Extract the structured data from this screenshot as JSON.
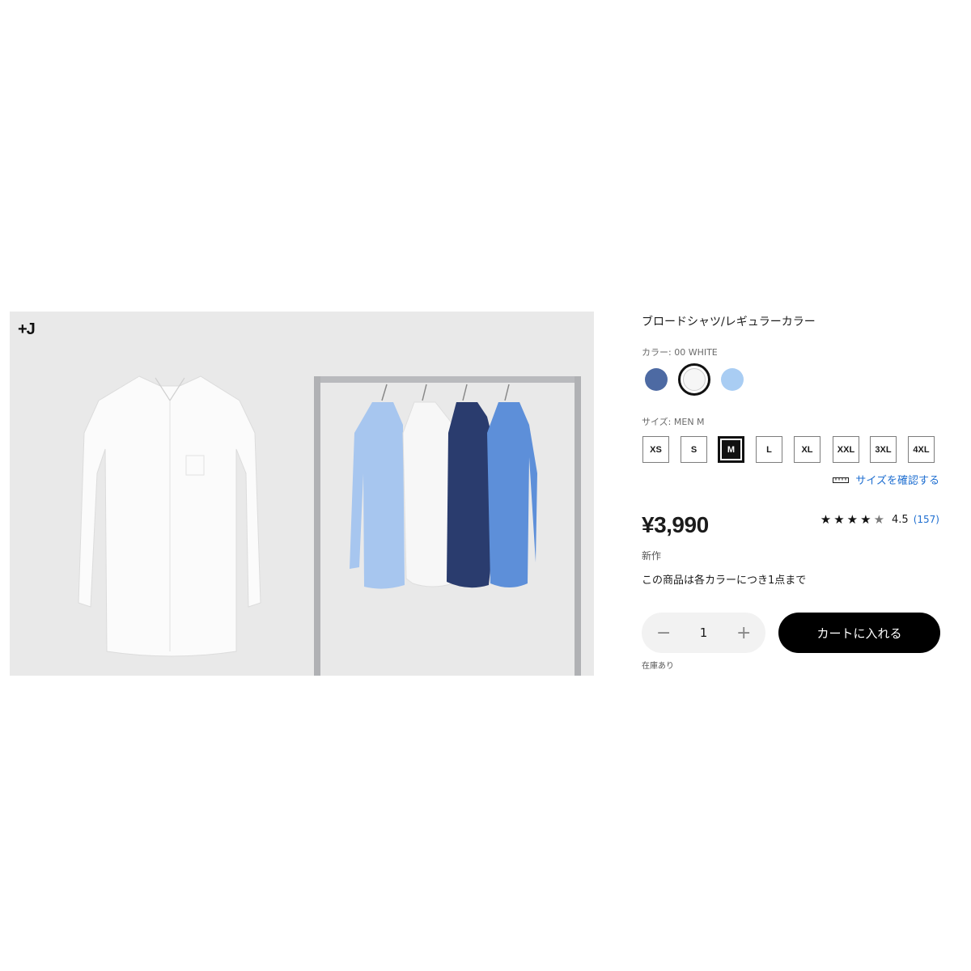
{
  "brand_logo": "+J",
  "product": {
    "title": "ブロードシャツ/レギュラーカラー",
    "color_label": "カラー: 00 WHITE",
    "colors": [
      {
        "name": "navy",
        "hex": "#4d6aa3"
      },
      {
        "name": "white",
        "hex": "#f6f6f6",
        "selected": true
      },
      {
        "name": "light-blue",
        "hex": "#a9cdf3"
      }
    ],
    "size_label": "サイズ: MEN M",
    "sizes": [
      "XS",
      "S",
      "M",
      "L",
      "XL",
      "XXL",
      "3XL",
      "4XL"
    ],
    "selected_size": "M",
    "size_guide": "サイズを確認する",
    "price": "¥3,990",
    "rating": {
      "stars": "★★★★",
      "half": "★",
      "value": "4.5",
      "count": "(157)"
    },
    "badge": "新作",
    "limit_note": "この商品は各カラーにつき1点まで",
    "quantity": {
      "minus": "−",
      "value": "1",
      "plus": "+"
    },
    "add_to_cart": "カートに入れる",
    "stock": "在庫あり"
  },
  "colors": {
    "accent_link": "#1f6fd1",
    "image_bg": "#e9e9e9"
  }
}
